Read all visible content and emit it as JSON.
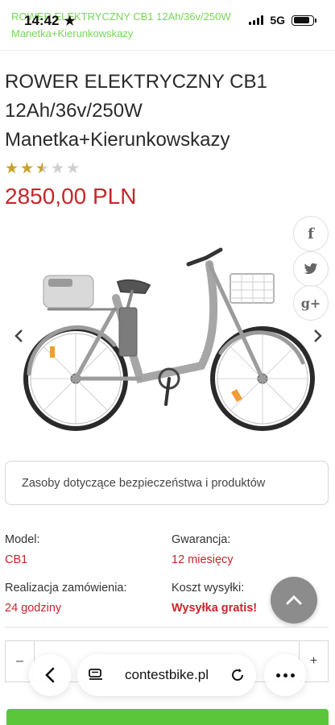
{
  "status_bar": {
    "time": "14:42",
    "network": "5G",
    "ghost_title_line1": "ROWER ELEKTRYCZNY CB1 12Ah/36v/250W",
    "ghost_title_line2": "Manetka+Kierunkowskazy",
    "battery_level": 0.85
  },
  "product": {
    "title": "ROWER ELEKTRYCZNY CB1 12Ah/36v/250W Manetka+Kierunkowskazy",
    "rating": 2.5,
    "rating_max": 5,
    "price": "2850,00 PLN"
  },
  "share": {
    "facebook_glyph": "f",
    "twitter_glyph": "t",
    "googleplus_glyph": "g+"
  },
  "resources_label": "Zasoby dotyczące bezpieczeństwa i produktów",
  "details": {
    "model_label": "Model:",
    "model_value": "CB1",
    "warranty_label": "Gwarancja:",
    "warranty_value": "12 miesięcy",
    "fulfillment_label": "Realizacja zamówienia:",
    "fulfillment_value": "24 godziny",
    "shipping_label": "Koszt wysyłki:",
    "shipping_value": "Wysyłka gratis!"
  },
  "quantity": {
    "minus": "–",
    "plus": "+"
  },
  "browser": {
    "url": "contestbike.pl"
  },
  "colors": {
    "price_red": "#c8262a",
    "accent_green": "#5cc63b",
    "star_gold": "#c9a227"
  }
}
